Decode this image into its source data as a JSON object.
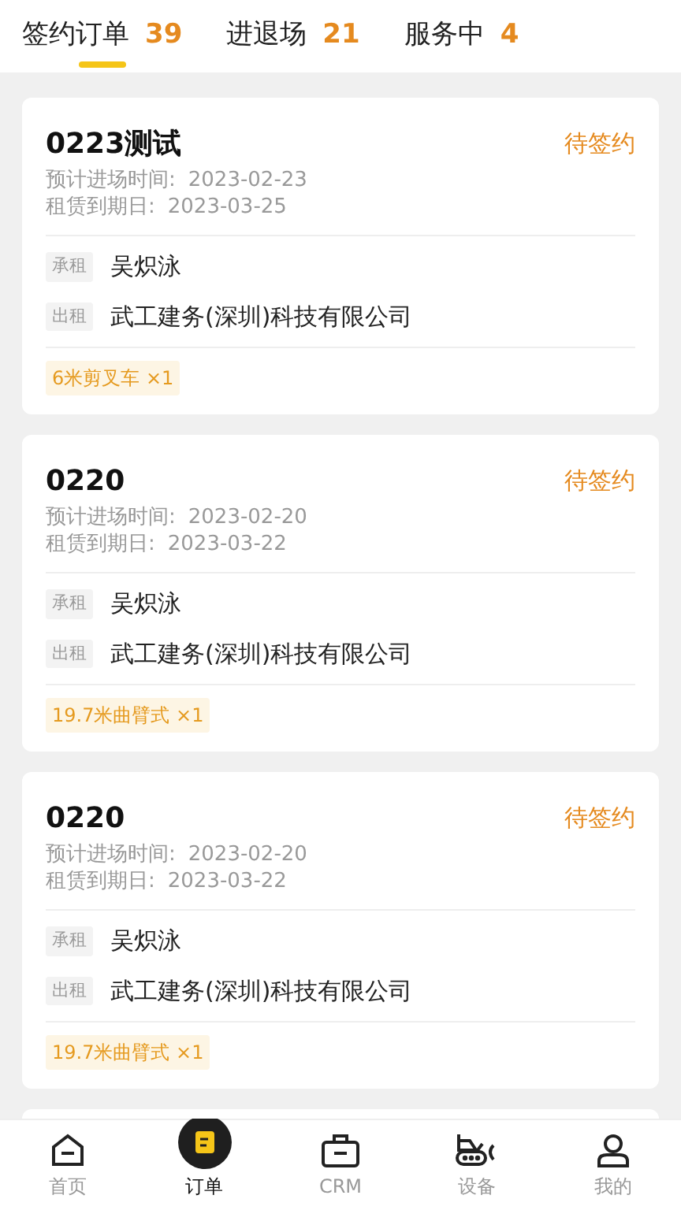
{
  "tabs": [
    {
      "label": "签约订单",
      "count": "39",
      "selected": true
    },
    {
      "label": "进退场",
      "count": "21",
      "selected": false
    },
    {
      "label": "服务中",
      "count": "4",
      "selected": false
    }
  ],
  "orders": [
    {
      "title": "0223测试",
      "status": "待签约",
      "entry_date_label": "预计进场时间:",
      "entry_date": "2023-02-23",
      "due_date_label": "租赁到期日:",
      "due_date": "2023-03-25",
      "lessee_tag": "承租",
      "lessee": "吴炽泳",
      "lessor_tag": "出租",
      "lessor": "武工建务(深圳)科技有限公司",
      "equipment": "6米剪叉车 ×1"
    },
    {
      "title": "0220",
      "status": "待签约",
      "entry_date_label": "预计进场时间:",
      "entry_date": "2023-02-20",
      "due_date_label": "租赁到期日:",
      "due_date": "2023-03-22",
      "lessee_tag": "承租",
      "lessee": "吴炽泳",
      "lessor_tag": "出租",
      "lessor": "武工建务(深圳)科技有限公司",
      "equipment": "19.7米曲臂式 ×1"
    },
    {
      "title": "0220",
      "status": "待签约",
      "entry_date_label": "预计进场时间:",
      "entry_date": "2023-02-20",
      "due_date_label": "租赁到期日:",
      "due_date": "2023-03-22",
      "lessee_tag": "承租",
      "lessee": "吴炽泳",
      "lessor_tag": "出租",
      "lessor": "武工建务(深圳)科技有限公司",
      "equipment": "19.7米曲臂式 ×1"
    }
  ],
  "nav": [
    {
      "label": "首页",
      "kind": "home",
      "selected": false
    },
    {
      "label": "订单",
      "kind": "orders",
      "selected": true
    },
    {
      "label": "CRM",
      "kind": "crm",
      "selected": false
    },
    {
      "label": "设备",
      "kind": "equipment",
      "selected": false
    },
    {
      "label": "我的",
      "kind": "profile",
      "selected": false
    }
  ]
}
